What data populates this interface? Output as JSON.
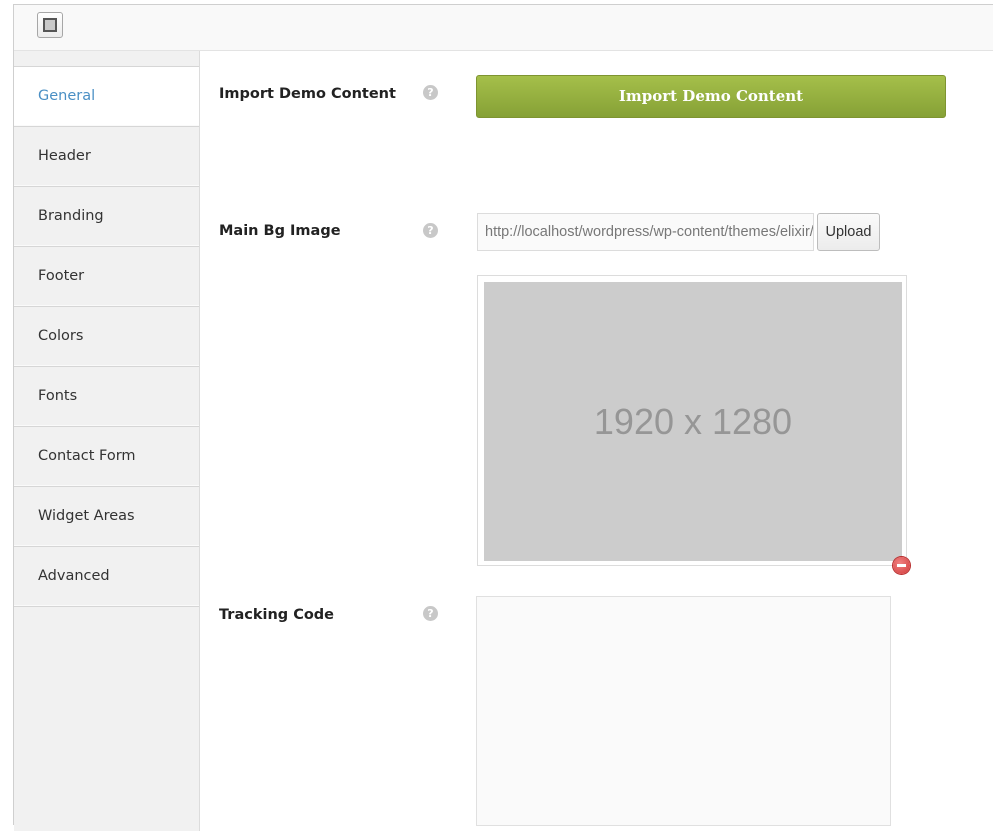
{
  "toolbar": {
    "toggle_icon": "panel-toggle-icon"
  },
  "sidebar": {
    "items": [
      {
        "label": "General",
        "active": true
      },
      {
        "label": "Header"
      },
      {
        "label": "Branding"
      },
      {
        "label": "Footer"
      },
      {
        "label": "Colors"
      },
      {
        "label": "Fonts"
      },
      {
        "label": "Contact Form"
      },
      {
        "label": "Widget Areas"
      },
      {
        "label": "Advanced"
      }
    ],
    "active_color": "#4a8fc4"
  },
  "fields": {
    "import_demo": {
      "label": "Import Demo Content",
      "button_label": "Import Demo Content",
      "button_color": "#97b040"
    },
    "main_bg_image": {
      "label": "Main Bg Image",
      "url_value": "http://localhost/wordpress/wp-content/themes/elixir/images/bg.jpg",
      "upload_label": "Upload",
      "preview_text": "1920 x 1280"
    },
    "tracking_code": {
      "label": "Tracking Code",
      "value": ""
    }
  },
  "help_glyph": "?"
}
